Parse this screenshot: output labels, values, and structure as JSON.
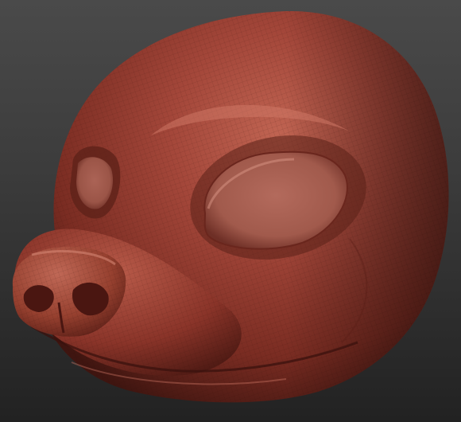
{
  "scene": {
    "subject": "sculpted-animal-head-3d-model",
    "material_color": "#8a3326",
    "material_highlight": "#c96a58",
    "material_shadow": "#3d1410",
    "background_top": "#4a4a4a",
    "background_bottom": "#222222",
    "wireframe_visible": true
  }
}
